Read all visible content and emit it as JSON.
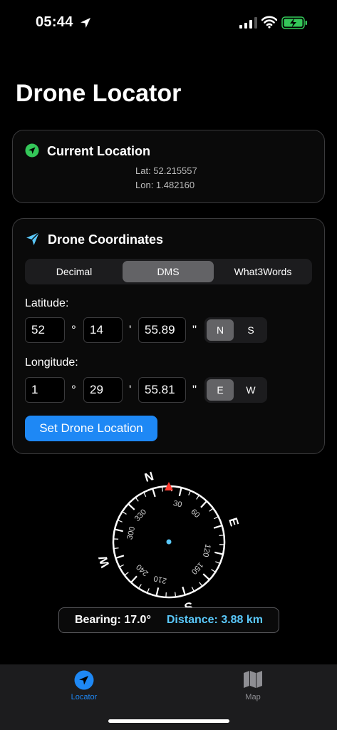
{
  "status_bar": {
    "time": "05:44"
  },
  "app": {
    "title": "Drone Locator"
  },
  "current_location": {
    "heading": "Current Location",
    "lat_text": "Lat: 52.215557",
    "lon_text": "Lon: 1.482160"
  },
  "drone": {
    "heading": "Drone Coordinates",
    "tabs": [
      {
        "label": "Decimal",
        "selected": false
      },
      {
        "label": "DMS",
        "selected": true
      },
      {
        "label": "What3Words",
        "selected": false
      }
    ],
    "latitude_label": "Latitude:",
    "latitude": {
      "deg": "52",
      "min": "14",
      "sec": "55.89",
      "options": [
        "N",
        "S"
      ],
      "selected": "N"
    },
    "longitude_label": "Longitude:",
    "longitude": {
      "deg": "1",
      "min": "29",
      "sec": "55.81",
      "options": [
        "E",
        "W"
      ],
      "selected": "E"
    },
    "degree_symbol": "°",
    "minute_symbol": "'",
    "second_symbol": "\"",
    "set_button": "Set Drone Location"
  },
  "compass": {
    "cardinals": {
      "n": "N",
      "e": "E",
      "s": "S",
      "w": "W"
    },
    "ticks": [
      "30",
      "60",
      "120",
      "150",
      "210",
      "240",
      "300",
      "330"
    ],
    "bearing_deg": 17.0
  },
  "info": {
    "bearing_text": "Bearing: 17.0°",
    "distance_text": "Distance: 3.88 km"
  },
  "colors": {
    "accent": "#1e88f5",
    "location_green": "#34c759",
    "drone_blue": "#5ac8fa",
    "distance_blue": "#5ac8fa",
    "marker_red": "#ff3b30",
    "battery_green": "#34c759"
  },
  "tabbar": {
    "items": [
      {
        "label": "Locator",
        "icon": "location-arrow-icon",
        "active": true
      },
      {
        "label": "Map",
        "icon": "map-icon",
        "active": false
      }
    ]
  }
}
